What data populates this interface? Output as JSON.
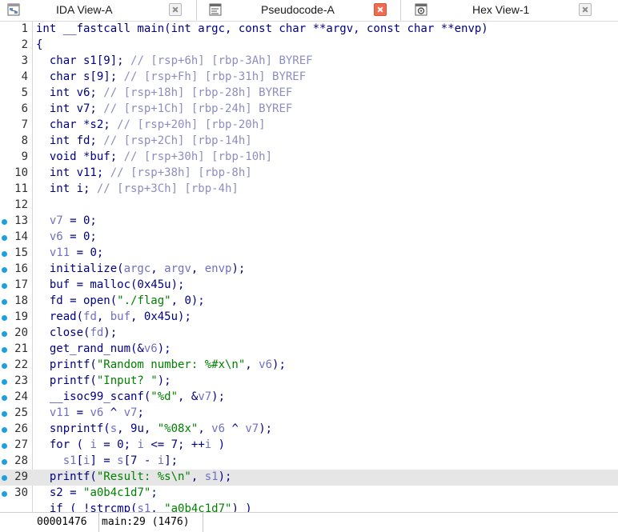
{
  "tabs": [
    {
      "label": "IDA View-A",
      "icon": "ida-view-icon",
      "active": false
    },
    {
      "label": "Pseudocode-A",
      "icon": "pseudocode-icon",
      "active": true
    },
    {
      "label": "Hex View-1",
      "icon": "hex-view-icon",
      "active": false
    }
  ],
  "colors": {
    "keyword": "#000080",
    "comment": "#8d8dc2",
    "string": "#008000",
    "variable": "#7070c0",
    "breakpoint_dot": "#1ea0e0",
    "highlight_line": "#e6e6e6",
    "active_close": "#f06b4f"
  },
  "code_lines": [
    {
      "num": "1",
      "dot": false,
      "hl": false,
      "segments": [
        [
          "kw",
          "int __fastcall main(int argc, const char **argv, const char **envp)"
        ]
      ]
    },
    {
      "num": "2",
      "dot": false,
      "hl": false,
      "segments": [
        [
          "kw",
          "{"
        ]
      ]
    },
    {
      "num": "3",
      "dot": false,
      "hl": false,
      "segments": [
        [
          "kw",
          "  char s1[9]; "
        ],
        [
          "cm",
          "// [rsp+6h] [rbp-3Ah] BYREF"
        ]
      ]
    },
    {
      "num": "4",
      "dot": false,
      "hl": false,
      "segments": [
        [
          "kw",
          "  char s[9]; "
        ],
        [
          "cm",
          "// [rsp+Fh] [rbp-31h] BYREF"
        ]
      ]
    },
    {
      "num": "5",
      "dot": false,
      "hl": false,
      "segments": [
        [
          "kw",
          "  int v6; "
        ],
        [
          "cm",
          "// [rsp+18h] [rbp-28h] BYREF"
        ]
      ]
    },
    {
      "num": "6",
      "dot": false,
      "hl": false,
      "segments": [
        [
          "kw",
          "  int v7; "
        ],
        [
          "cm",
          "// [rsp+1Ch] [rbp-24h] BYREF"
        ]
      ]
    },
    {
      "num": "7",
      "dot": false,
      "hl": false,
      "segments": [
        [
          "kw",
          "  char *s2; "
        ],
        [
          "cm",
          "// [rsp+20h] [rbp-20h]"
        ]
      ]
    },
    {
      "num": "8",
      "dot": false,
      "hl": false,
      "segments": [
        [
          "kw",
          "  int fd; "
        ],
        [
          "cm",
          "// [rsp+2Ch] [rbp-14h]"
        ]
      ]
    },
    {
      "num": "9",
      "dot": false,
      "hl": false,
      "segments": [
        [
          "kw",
          "  void *buf; "
        ],
        [
          "cm",
          "// [rsp+30h] [rbp-10h]"
        ]
      ]
    },
    {
      "num": "10",
      "dot": false,
      "hl": false,
      "segments": [
        [
          "kw",
          "  int v11; "
        ],
        [
          "cm",
          "// [rsp+38h] [rbp-8h]"
        ]
      ]
    },
    {
      "num": "11",
      "dot": false,
      "hl": false,
      "segments": [
        [
          "kw",
          "  int i; "
        ],
        [
          "cm",
          "// [rsp+3Ch] [rbp-4h]"
        ]
      ]
    },
    {
      "num": "12",
      "dot": false,
      "hl": false,
      "segments": [
        [
          "kw",
          ""
        ]
      ]
    },
    {
      "num": "13",
      "dot": true,
      "hl": false,
      "segments": [
        [
          "kw",
          "  "
        ],
        [
          "vr",
          "v7"
        ],
        [
          "kw",
          " = 0;"
        ]
      ]
    },
    {
      "num": "14",
      "dot": true,
      "hl": false,
      "segments": [
        [
          "kw",
          "  "
        ],
        [
          "vr",
          "v6"
        ],
        [
          "kw",
          " = 0;"
        ]
      ]
    },
    {
      "num": "15",
      "dot": true,
      "hl": false,
      "segments": [
        [
          "kw",
          "  "
        ],
        [
          "vr",
          "v11"
        ],
        [
          "kw",
          " = 0;"
        ]
      ]
    },
    {
      "num": "16",
      "dot": true,
      "hl": false,
      "segments": [
        [
          "kw",
          "  initialize("
        ],
        [
          "vr",
          "argc"
        ],
        [
          "kw",
          ", "
        ],
        [
          "vr",
          "argv"
        ],
        [
          "kw",
          ", "
        ],
        [
          "vr",
          "envp"
        ],
        [
          "kw",
          ");"
        ]
      ]
    },
    {
      "num": "17",
      "dot": true,
      "hl": false,
      "segments": [
        [
          "kw",
          "  buf = malloc(0x45u);"
        ]
      ]
    },
    {
      "num": "18",
      "dot": true,
      "hl": false,
      "segments": [
        [
          "kw",
          "  fd = open("
        ],
        [
          "st",
          "\"./flag\""
        ],
        [
          "kw",
          ", 0);"
        ]
      ]
    },
    {
      "num": "19",
      "dot": true,
      "hl": false,
      "segments": [
        [
          "kw",
          "  read("
        ],
        [
          "vr",
          "fd"
        ],
        [
          "kw",
          ", "
        ],
        [
          "vr",
          "buf"
        ],
        [
          "kw",
          ", 0x45u);"
        ]
      ]
    },
    {
      "num": "20",
      "dot": true,
      "hl": false,
      "segments": [
        [
          "kw",
          "  close("
        ],
        [
          "vr",
          "fd"
        ],
        [
          "kw",
          ");"
        ]
      ]
    },
    {
      "num": "21",
      "dot": true,
      "hl": false,
      "segments": [
        [
          "kw",
          "  get_rand_num(&"
        ],
        [
          "vr",
          "v6"
        ],
        [
          "kw",
          ");"
        ]
      ]
    },
    {
      "num": "22",
      "dot": true,
      "hl": false,
      "segments": [
        [
          "kw",
          "  printf("
        ],
        [
          "st",
          "\"Random number: %#x\\n\""
        ],
        [
          "kw",
          ", "
        ],
        [
          "vr",
          "v6"
        ],
        [
          "kw",
          ");"
        ]
      ]
    },
    {
      "num": "23",
      "dot": true,
      "hl": false,
      "segments": [
        [
          "kw",
          "  printf("
        ],
        [
          "st",
          "\"Input? \""
        ],
        [
          "kw",
          ");"
        ]
      ]
    },
    {
      "num": "24",
      "dot": true,
      "hl": false,
      "segments": [
        [
          "kw",
          "  __isoc99_scanf("
        ],
        [
          "st",
          "\"%d\""
        ],
        [
          "kw",
          ", &"
        ],
        [
          "vr",
          "v7"
        ],
        [
          "kw",
          ");"
        ]
      ]
    },
    {
      "num": "25",
      "dot": true,
      "hl": false,
      "segments": [
        [
          "kw",
          "  "
        ],
        [
          "vr",
          "v11"
        ],
        [
          "kw",
          " = "
        ],
        [
          "vr",
          "v6"
        ],
        [
          "kw",
          " ^ "
        ],
        [
          "vr",
          "v7"
        ],
        [
          "kw",
          ";"
        ]
      ]
    },
    {
      "num": "26",
      "dot": true,
      "hl": false,
      "segments": [
        [
          "kw",
          "  snprintf("
        ],
        [
          "vr",
          "s"
        ],
        [
          "kw",
          ", 9u, "
        ],
        [
          "st",
          "\"%08x\""
        ],
        [
          "kw",
          ", "
        ],
        [
          "vr",
          "v6"
        ],
        [
          "kw",
          " ^ "
        ],
        [
          "vr",
          "v7"
        ],
        [
          "kw",
          ");"
        ]
      ]
    },
    {
      "num": "27",
      "dot": true,
      "hl": false,
      "segments": [
        [
          "kw",
          "  for ( "
        ],
        [
          "vr",
          "i"
        ],
        [
          "kw",
          " = 0; "
        ],
        [
          "vr",
          "i"
        ],
        [
          "kw",
          " <= 7; ++"
        ],
        [
          "vr",
          "i"
        ],
        [
          "kw",
          " )"
        ]
      ]
    },
    {
      "num": "28",
      "dot": true,
      "hl": false,
      "segments": [
        [
          "kw",
          "    "
        ],
        [
          "vr",
          "s1"
        ],
        [
          "kw",
          "["
        ],
        [
          "vr",
          "i"
        ],
        [
          "kw",
          "] = "
        ],
        [
          "vr",
          "s"
        ],
        [
          "kw",
          "[7 - "
        ],
        [
          "vr",
          "i"
        ],
        [
          "kw",
          "];"
        ]
      ]
    },
    {
      "num": "29",
      "dot": true,
      "hl": true,
      "segments": [
        [
          "kw",
          "  printf("
        ],
        [
          "st",
          "\"Result: %s\\n\""
        ],
        [
          "kw",
          ", "
        ],
        [
          "vr",
          "s1"
        ],
        [
          "kw",
          ");"
        ]
      ]
    },
    {
      "num": "30",
      "dot": true,
      "hl": false,
      "segments": [
        [
          "kw",
          "  s2 = "
        ],
        [
          "st",
          "\"a0b4c1d7\""
        ],
        [
          "kw",
          ";"
        ]
      ]
    },
    {
      "num": "",
      "dot": false,
      "hl": false,
      "segments": [
        [
          "kw",
          "  if ( !strcmp("
        ],
        [
          "vr",
          "s1"
        ],
        [
          "kw",
          ", "
        ],
        [
          "st",
          "\"a0b4c1d7\""
        ],
        [
          "kw",
          ") )"
        ]
      ]
    }
  ],
  "status": {
    "address": "00001476",
    "location": "main:29 (1476)"
  }
}
